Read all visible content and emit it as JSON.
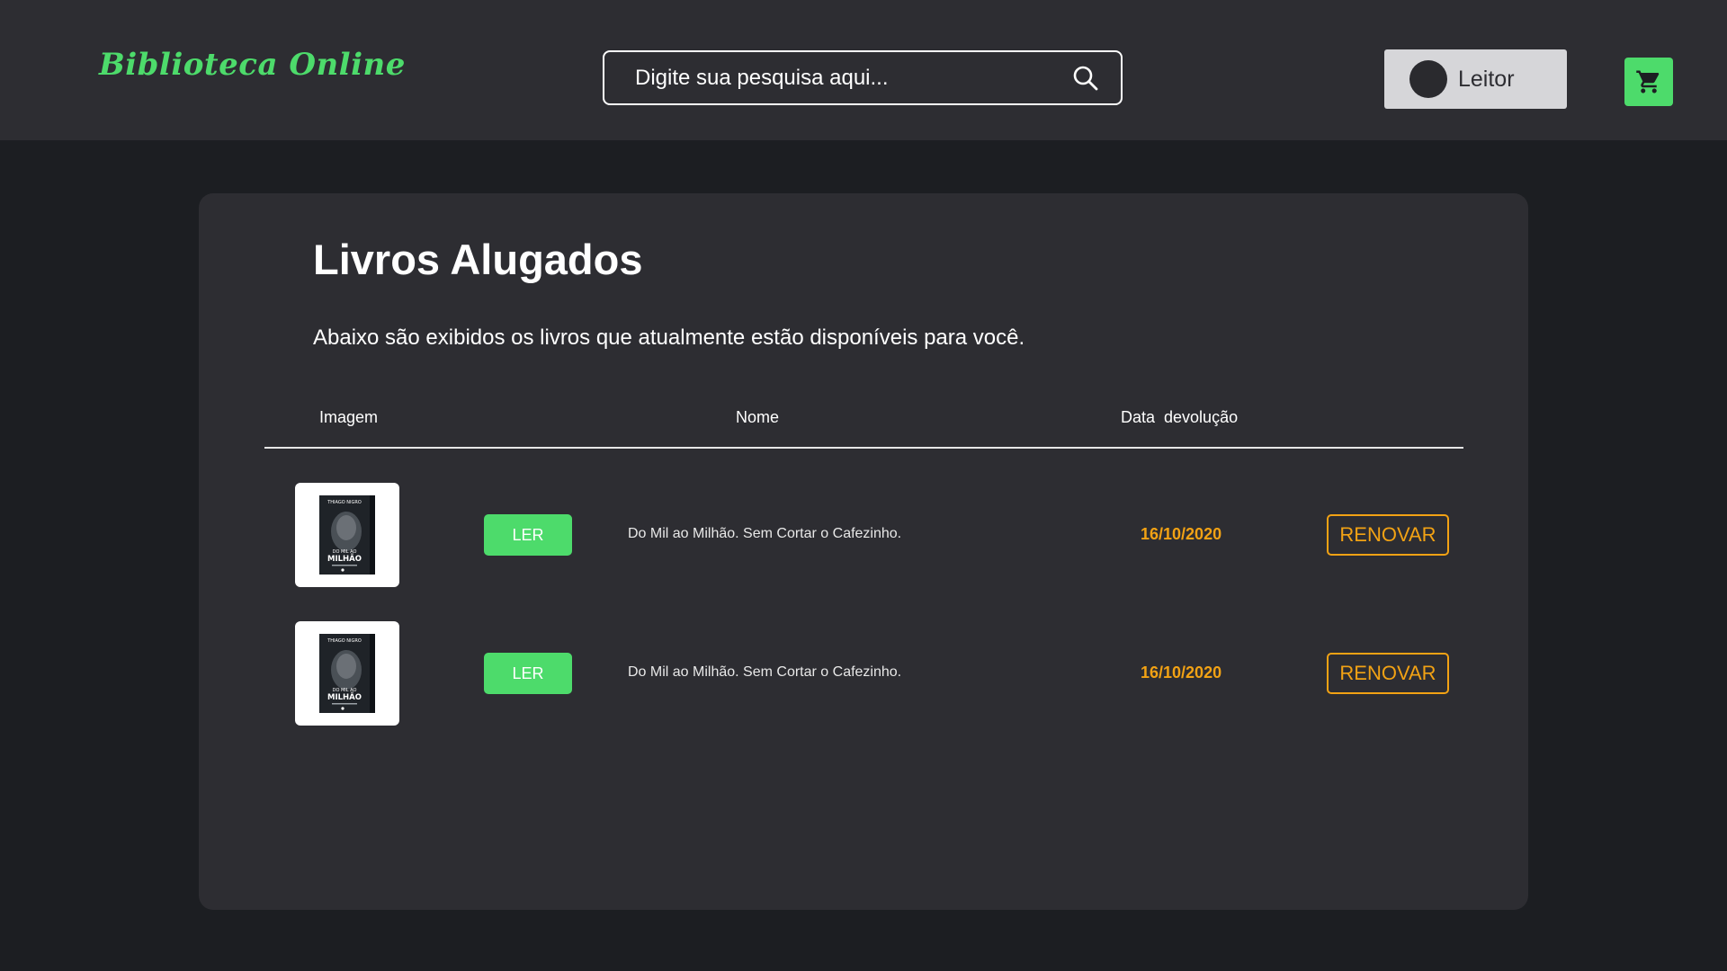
{
  "header": {
    "brand": "Biblioteca Online",
    "search_placeholder": "Digite sua pesquisa aqui...",
    "user_label": "Leitor",
    "search_icon": "search-icon",
    "cart_icon": "shopping-cart-icon"
  },
  "main": {
    "title": "Livros Alugados",
    "description": "Abaixo são exibidos os livros que atualmente estão disponíveis para você.",
    "table": {
      "columns": [
        "Imagem",
        "Nome",
        "Data  devolução"
      ],
      "rows": [
        {
          "read_label": "LER",
          "name": "Do Mil ao Milhão. Sem Cortar o Cafezinho.",
          "due_date": "16/10/2020",
          "renew_label": "RENOVAR",
          "cover": {
            "author": "THIAGO NIGRO",
            "title_line1": "DO MIL AO",
            "title_line2": "MILHÃO"
          }
        },
        {
          "read_label": "LER",
          "name": "Do Mil ao Milhão. Sem Cortar o Cafezinho.",
          "due_date": "16/10/2020",
          "renew_label": "RENOVAR",
          "cover": {
            "author": "THIAGO NIGRO",
            "title_line1": "DO MIL AO",
            "title_line2": "MILHÃO"
          }
        }
      ]
    }
  },
  "colors": {
    "accent_green": "#4ddb6b",
    "accent_orange": "#f2a214",
    "header_bg": "#2d2d32",
    "page_bg": "#1c1e22"
  }
}
